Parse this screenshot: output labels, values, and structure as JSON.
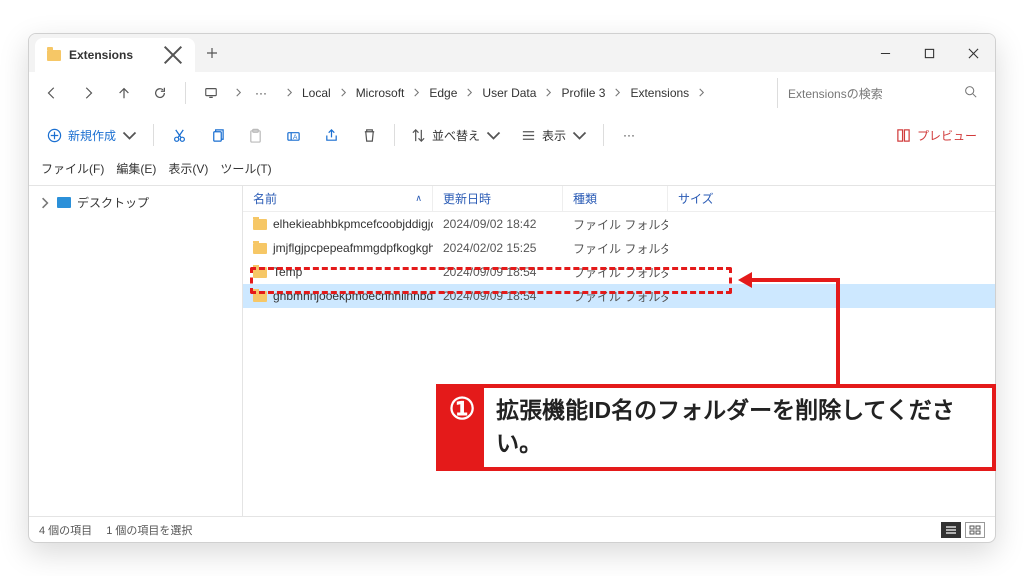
{
  "tab": {
    "title": "Extensions"
  },
  "breadcrumb": {
    "segments": [
      "Local",
      "Microsoft",
      "Edge",
      "User Data",
      "Profile 3",
      "Extensions"
    ]
  },
  "search": {
    "placeholder": "Extensionsの検索"
  },
  "toolbar": {
    "new": "新規作成",
    "sort": "並べ替え",
    "view": "表示",
    "preview": "プレビュー"
  },
  "menubar": {
    "file": "ファイル(F)",
    "edit": "編集(E)",
    "view": "表示(V)",
    "tool": "ツール(T)"
  },
  "sidebar": {
    "desktop": "デスクトップ"
  },
  "columns": {
    "name": "名前",
    "date": "更新日時",
    "type": "種類",
    "size": "サイズ"
  },
  "rows": [
    {
      "name": "elhekieabhbkpmcefcoobjddigjcaadp",
      "date": "2024/09/02 18:42",
      "type": "ファイル フォルダー",
      "size": ""
    },
    {
      "name": "jmjflgjpcpepeafmmgdpfkogkghcpiha",
      "date": "2024/02/02 15:25",
      "type": "ファイル フォルダー",
      "size": ""
    },
    {
      "name": "Temp",
      "date": "2024/09/09 18:54",
      "type": "ファイル フォルダー",
      "size": ""
    },
    {
      "name": "ghbmnnjooekpmoecnnnilnnbdlolhkhi",
      "date": "2024/09/09 18:54",
      "type": "ファイル フォルダー",
      "size": ""
    }
  ],
  "status": {
    "count": "4 個の項目",
    "selected": "1 個の項目を選択"
  },
  "callout": {
    "badge": "①",
    "text": "拡張機能ID名のフォルダーを削除してください。"
  }
}
